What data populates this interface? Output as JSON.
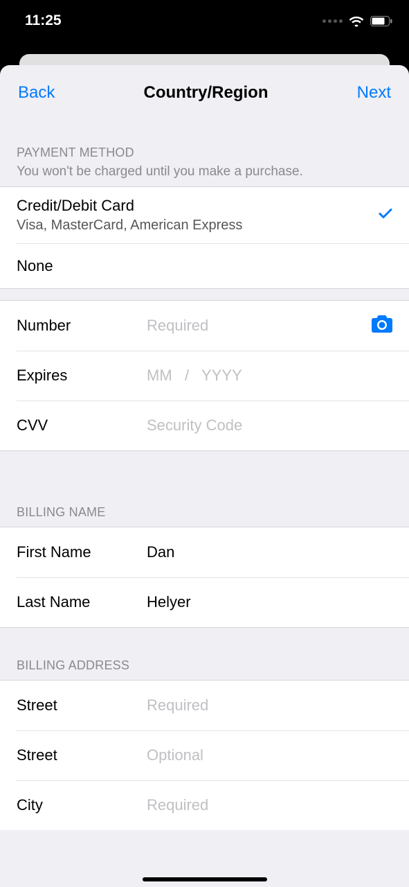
{
  "status": {
    "time": "11:25"
  },
  "nav": {
    "back": "Back",
    "title": "Country/Region",
    "next": "Next"
  },
  "payment_method": {
    "header": "PAYMENT METHOD",
    "note": "You won't be charged until you make a purchase.",
    "options": {
      "card": {
        "title": "Credit/Debit Card",
        "subtitle": "Visa, MasterCard, American Express"
      },
      "none": {
        "title": "None"
      }
    }
  },
  "card_fields": {
    "number": {
      "label": "Number",
      "placeholder": "Required",
      "value": ""
    },
    "expires": {
      "label": "Expires",
      "placeholder": "MM   /   YYYY",
      "value": ""
    },
    "cvv": {
      "label": "CVV",
      "placeholder": "Security Code",
      "value": ""
    }
  },
  "billing_name": {
    "header": "BILLING NAME",
    "first": {
      "label": "First Name",
      "value": "Dan"
    },
    "last": {
      "label": "Last Name",
      "value": "Helyer"
    }
  },
  "billing_address": {
    "header": "BILLING ADDRESS",
    "street1": {
      "label": "Street",
      "placeholder": "Required",
      "value": ""
    },
    "street2": {
      "label": "Street",
      "placeholder": "Optional",
      "value": ""
    },
    "city": {
      "label": "City",
      "placeholder": "Required",
      "value": ""
    }
  }
}
